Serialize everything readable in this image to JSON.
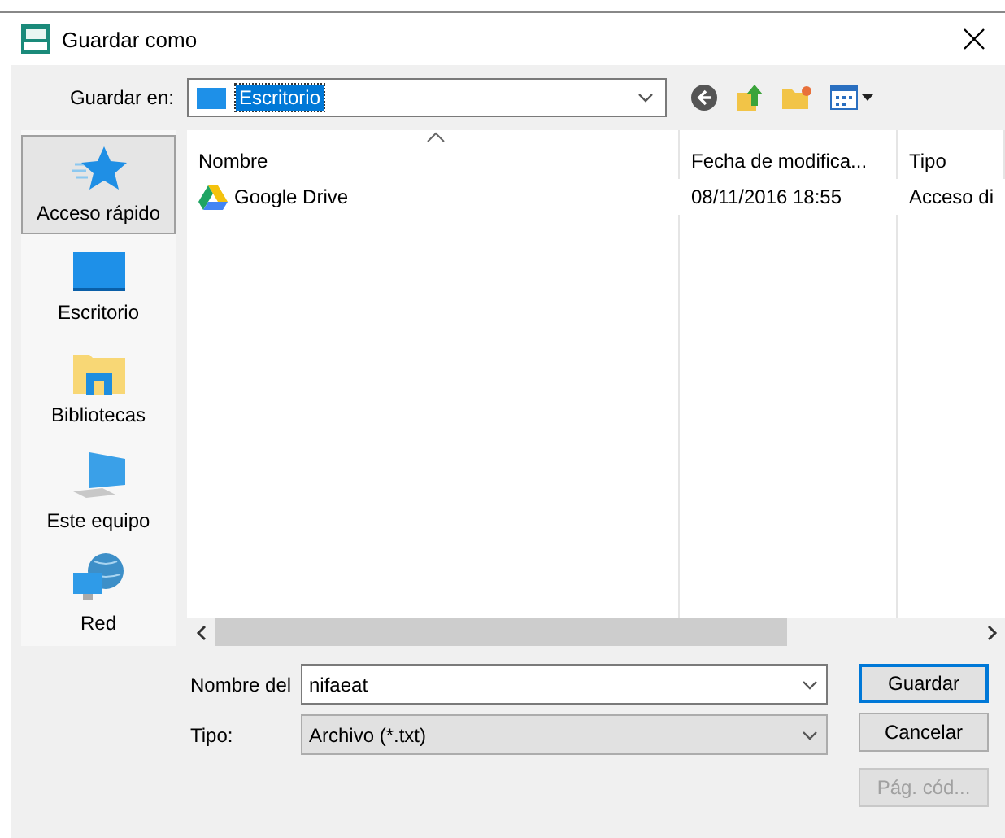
{
  "window": {
    "title": "Guardar como"
  },
  "save_in": {
    "label": "Guardar en:",
    "value": "Escritorio"
  },
  "places": [
    {
      "kind": "star",
      "label": "Acceso rápido",
      "selected": true
    },
    {
      "kind": "desktop",
      "label": "Escritorio",
      "selected": false
    },
    {
      "kind": "library",
      "label": "Bibliotecas",
      "selected": false
    },
    {
      "kind": "computer",
      "label": "Este equipo",
      "selected": false
    },
    {
      "kind": "network",
      "label": "Red",
      "selected": false
    }
  ],
  "columns": [
    "Nombre",
    "Fecha de modifica...",
    "Tipo"
  ],
  "rows": [
    {
      "name": "Google Drive",
      "date": "08/11/2016 18:55",
      "type": "Acceso di",
      "selected": false
    }
  ],
  "file_name": {
    "label": "Nombre del",
    "value": "nifaeat"
  },
  "file_type": {
    "label": "Tipo:",
    "value": "Archivo (*.txt)"
  },
  "buttons": [
    {
      "label": "Guardar",
      "default": true,
      "disabled": false
    },
    {
      "label": "Cancelar",
      "default": false,
      "disabled": false
    },
    {
      "label": "Pág. cód...",
      "default": false,
      "disabled": true
    }
  ]
}
